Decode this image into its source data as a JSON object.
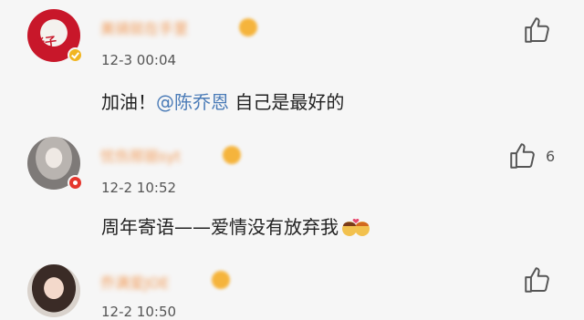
{
  "comments": [
    {
      "time": "12-3 00:04",
      "text_before": "加油！",
      "mention": "@陈乔恩",
      "text_after": " 自己是最好的",
      "badge": "gold",
      "likes": ""
    },
    {
      "time": "12-2 10:52",
      "text_before": "周年寄语——爱情没有放弃我",
      "mention": "",
      "text_after": "",
      "badge": "red",
      "likes": "6"
    },
    {
      "time": "12-2 10:50",
      "text_before": "",
      "mention": "",
      "text_after": "",
      "badge": "",
      "likes": ""
    }
  ],
  "icons": {
    "like": "thumbs-up-icon",
    "emoji": "kissing-couple-emoji"
  },
  "colors": {
    "username": "#f08a3c",
    "mention": "#4a7bb7",
    "badge_gold": "#f1b521",
    "badge_red": "#e5362d"
  }
}
